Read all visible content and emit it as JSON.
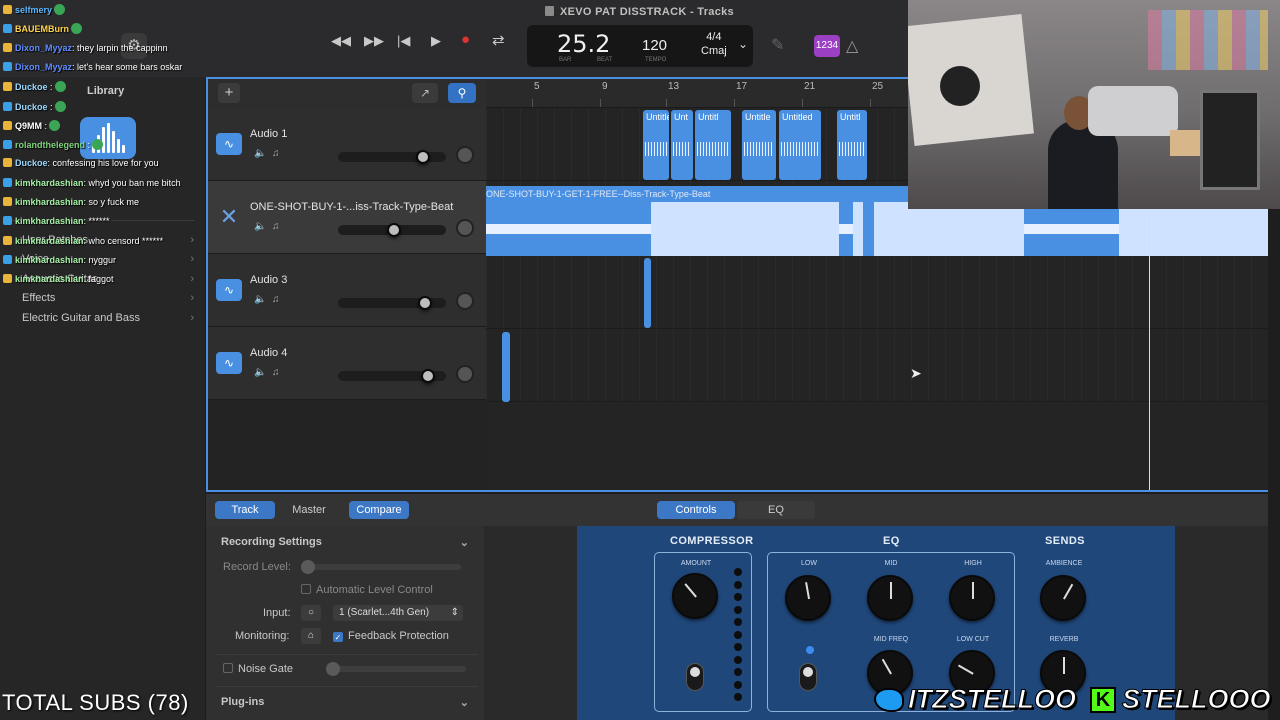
{
  "window": {
    "title": "XEVO PAT DISSTRACK - Tracks"
  },
  "transport": {
    "rewind": "◀◀",
    "forward": "▶▶",
    "to_start": "|◀",
    "play": "▶",
    "record": "●",
    "cycle": "⇄",
    "position": "25.2",
    "bar_label": "BAR",
    "beat_label": "BEAT",
    "tempo": "120",
    "tempo_label": "TEMPO",
    "signature": "4/4",
    "key": "Cmaj",
    "count_in": "1234"
  },
  "library": {
    "title": "Library",
    "categories": [
      "User Patches",
      "Voice",
      "Acoustic Guitar",
      "Effects",
      "Electric Guitar and Bass"
    ]
  },
  "tracks": [
    {
      "name": "Audio 1",
      "pan_value": 0.83
    },
    {
      "name": "ONE-SHOT-BUY-1-...iss-Track-Type-Beat",
      "pan_value": 0.52
    },
    {
      "name": "Audio 3",
      "pan_value": 0.85
    },
    {
      "name": "Audio 4",
      "pan_value": 0.88
    }
  ],
  "ruler": {
    "bars": [
      "5",
      "9",
      "13",
      "17",
      "21",
      "25"
    ]
  },
  "regions": {
    "audio1": [
      "Untitle",
      "Unt",
      "Untitl",
      "Untitle",
      "Untitled",
      "Untitl"
    ],
    "beat": "ONE-SHOT-BUY-1-GET-1-FREE--Diss-Track-Type-Beat"
  },
  "editor": {
    "tabs_left": [
      "Track",
      "Master",
      "Compare"
    ],
    "tabs_right": [
      "Controls",
      "EQ"
    ],
    "recording_settings": "Recording Settings",
    "record_level": "Record Level:",
    "auto_level": "Automatic Level Control",
    "input_label": "Input:",
    "input_value": "1 (Scarlet...4th Gen)",
    "monitoring_label": "Monitoring:",
    "feedback_protection": "Feedback Protection",
    "noise_gate": "Noise Gate",
    "plugins": "Plug-ins"
  },
  "plugin": {
    "sections": [
      "COMPRESSOR",
      "EQ",
      "SENDS"
    ],
    "knobs": {
      "amount": "AMOUNT",
      "low": "LOW",
      "mid": "MID",
      "high": "HIGH",
      "mid_freq": "MID FREQ",
      "low_cut": "LOW CUT",
      "ambience": "AMBIENCE",
      "reverb": "REVERB"
    }
  },
  "chat": [
    {
      "user": "selfmery",
      "msg": "",
      "color": "#5db7ff"
    },
    {
      "user": "BAUEMBurn",
      "msg": "",
      "color": "#ffd34d"
    },
    {
      "user": "Dixon_Myyaz",
      "msg": ": they larpin the cappinn",
      "color": "#5d8cff"
    },
    {
      "user": "Dixon_Myyaz",
      "msg": ": let's hear some bars oskar",
      "color": "#5d8cff"
    },
    {
      "user": "Duckoe",
      "msg": " :",
      "color": "#9ad8ff"
    },
    {
      "user": "Duckoe",
      "msg": " :",
      "color": "#9ad8ff"
    },
    {
      "user": "Q9MM",
      "msg": " :",
      "color": "#ffffff"
    },
    {
      "user": "rolandthelegend",
      "msg": " :",
      "color": "#7dd37d"
    },
    {
      "user": "Duckoe",
      "msg": ": confessing his love for you",
      "color": "#9ad8ff"
    },
    {
      "user": "kimkhardashian",
      "msg": ": whyd you ban me bitch",
      "color": "#a6f0a6"
    },
    {
      "user": "kimkhardashian",
      "msg": ": so y fuck me",
      "color": "#a6f0a6"
    },
    {
      "user": "kimkhardashian",
      "msg": ": ******",
      "color": "#a6f0a6"
    },
    {
      "user": "kimkhardashian",
      "msg": ": who censord ******",
      "color": "#a6f0a6"
    },
    {
      "user": "kimkhardashian",
      "msg": ": nyggur",
      "color": "#a6f0a6"
    },
    {
      "user": "kimkhardashian",
      "msg": ": faggot",
      "color": "#a6f0a6"
    }
  ],
  "stream": {
    "subs": "TOTAL SUBS (78)",
    "twitter": "ITZSTELLOO",
    "kick": "STELLOOO"
  },
  "colors": {
    "accent": "#4a90e2",
    "record": "#e0322f",
    "count_in": "#9b3fc4"
  }
}
